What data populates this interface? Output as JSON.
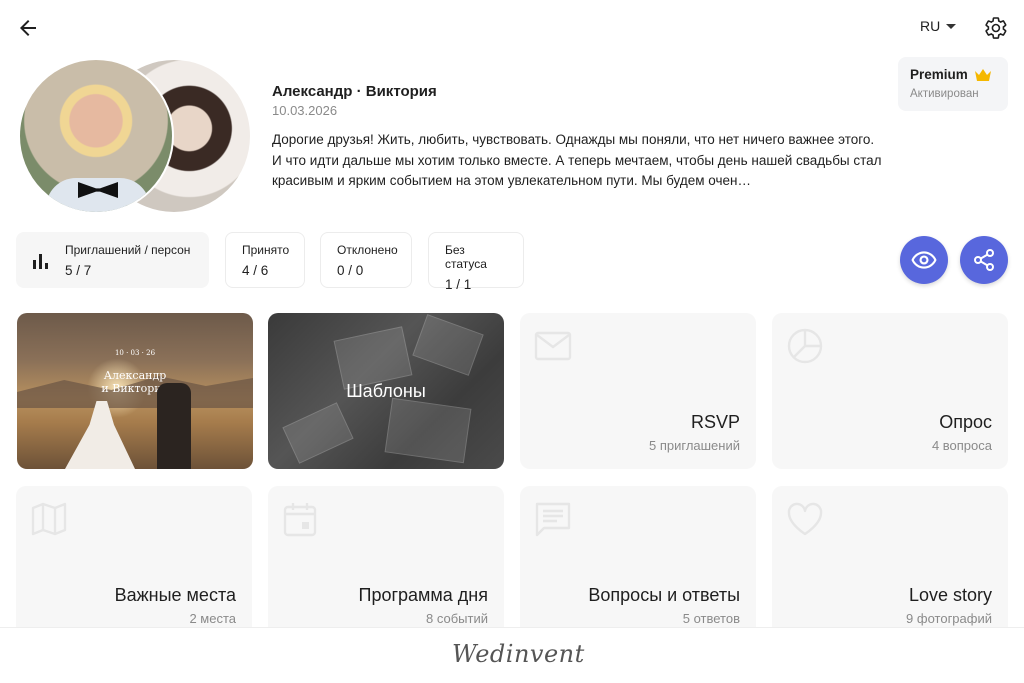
{
  "header": {
    "language": "RU"
  },
  "profile": {
    "couple_names": "Александр · Виктория",
    "date": "10.03.2026",
    "description": "Дорогие друзья! Жить, любить, чувствовать. Однажды мы поняли, что нет ничего важнее этого. И что идти дальше мы хотим только вместе. А теперь мечтаем, чтобы день нашей свадьбы стал красивым и ярким событием на этом увлекательном пути. Мы будем очен…"
  },
  "premium": {
    "title": "Premium",
    "status": "Активирован"
  },
  "stats": [
    {
      "label": "Приглашений / персон",
      "value": "5 / 7"
    },
    {
      "label": "Принято",
      "value": "4 / 6"
    },
    {
      "label": "Отклонено",
      "value": "0 / 0"
    },
    {
      "label": "Без статуса",
      "value": "1 / 1"
    }
  ],
  "cards": {
    "invitation_preview": {
      "date": "10 · 03 · 26",
      "names": "Александр\nи Виктория"
    },
    "templates": {
      "title": "Шаблоны"
    },
    "rsvp": {
      "title": "RSVP",
      "subtitle": "5 приглашений",
      "icon": "envelope-icon"
    },
    "poll": {
      "title": "Опрос",
      "subtitle": "4 вопроса",
      "icon": "pie-chart-icon"
    },
    "places": {
      "title": "Важные места",
      "subtitle": "2 места",
      "icon": "map-icon"
    },
    "schedule": {
      "title": "Программа дня",
      "subtitle": "8 событий",
      "icon": "calendar-icon"
    },
    "faq": {
      "title": "Вопросы и ответы",
      "subtitle": "5 ответов",
      "icon": "chat-icon"
    },
    "love_story": {
      "title": "Love story",
      "subtitle": "9 фотографий",
      "icon": "heart-icon"
    }
  },
  "footer": {
    "logo": "Wedinvent"
  },
  "colors": {
    "accent": "#5867dd",
    "crown": "#f5b800"
  }
}
